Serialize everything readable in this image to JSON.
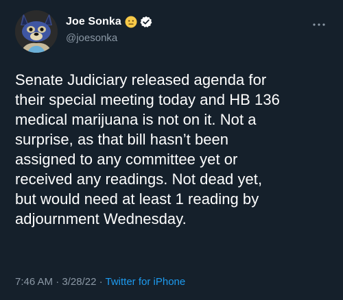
{
  "user": {
    "display_name": "Joe Sonka",
    "handle": "@joesonka",
    "emoji": "neutral-face-emoji",
    "badge": "verified-badge"
  },
  "tweet": {
    "text": "Senate Judiciary released agenda for\ntheir special meeting today and HB 136\nmedical marijuana is not on it. Not a\nsurprise, as that bill hasn’t been\nassigned to any committee yet or\nreceived any readings. Not dead yet,\nbut would need at least 1 reading by\nadjournment Wednesday."
  },
  "meta": {
    "time": "7:46 AM",
    "sep1": " · ",
    "date": "3/28/22",
    "sep2": " · ",
    "source": "Twitter for iPhone"
  },
  "colors": {
    "background": "#15202b",
    "muted": "#8b98a5",
    "link": "#1d9bf0",
    "text": "#ffffff"
  }
}
